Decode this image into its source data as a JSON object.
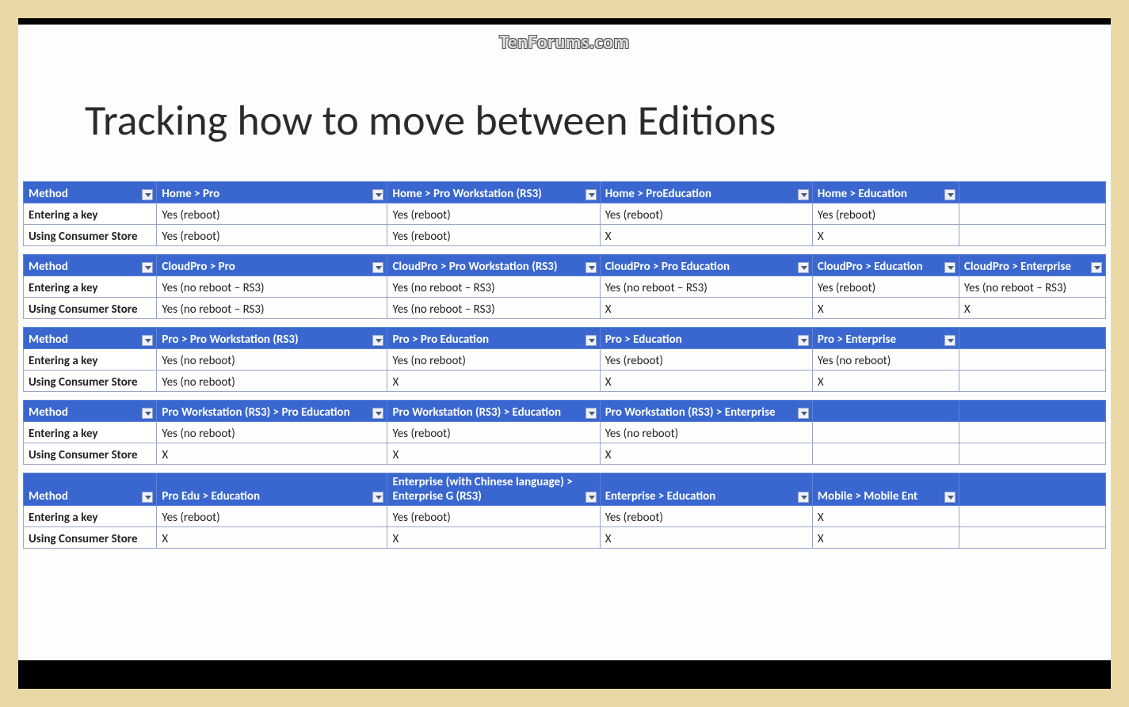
{
  "watermark": "TenForums.com",
  "title": "Tracking how to move between Editions",
  "colHeaders": {
    "method": "Method"
  },
  "tables": [
    {
      "cols": [
        "Home > Pro",
        "Home > Pro Workstation (RS3)",
        "Home > ProEducation",
        "Home > Education",
        ""
      ],
      "rows": [
        {
          "label": "Entering a key",
          "cells": [
            "Yes (reboot)",
            "Yes (reboot)",
            "Yes (reboot)",
            "Yes (reboot)",
            ""
          ]
        },
        {
          "label": "Using Consumer Store",
          "cells": [
            "Yes (reboot)",
            "Yes (reboot)",
            "X",
            "X",
            ""
          ]
        }
      ]
    },
    {
      "cols": [
        "CloudPro > Pro",
        "CloudPro > Pro Workstation (RS3)",
        "CloudPro > Pro Education",
        "CloudPro > Education",
        "CloudPro > Enterprise"
      ],
      "rows": [
        {
          "label": "Entering a key",
          "cells": [
            "Yes (no reboot – RS3)",
            "Yes (no reboot – RS3)",
            "Yes (no reboot – RS3)",
            "Yes (reboot)",
            "Yes (no reboot – RS3)"
          ]
        },
        {
          "label": "Using Consumer Store",
          "cells": [
            "Yes (no reboot – RS3)",
            "Yes (no reboot – RS3)",
            "X",
            "X",
            "X"
          ]
        }
      ]
    },
    {
      "cols": [
        "Pro > Pro Workstation (RS3)",
        "Pro > Pro Education",
        "Pro > Education",
        "Pro > Enterprise",
        ""
      ],
      "rows": [
        {
          "label": "Entering a key",
          "cells": [
            "Yes (no reboot)",
            "Yes (no reboot)",
            "Yes (reboot)",
            "Yes (no reboot)",
            ""
          ]
        },
        {
          "label": "Using Consumer Store",
          "cells": [
            "Yes (no reboot)",
            "X",
            "X",
            "X",
            ""
          ]
        }
      ]
    },
    {
      "tallHeader": true,
      "cols": [
        "Pro Workstation (RS3) > Pro Education",
        "Pro Workstation (RS3) > Education",
        "Pro Workstation (RS3) > Enterprise",
        "",
        ""
      ],
      "rows": [
        {
          "label": "Entering a key",
          "cells": [
            "Yes (no reboot)",
            "Yes (reboot)",
            "Yes (no reboot)",
            "",
            ""
          ]
        },
        {
          "label": "Using Consumer Store",
          "cells": [
            "X",
            "X",
            "X",
            "",
            ""
          ]
        }
      ]
    },
    {
      "cols": [
        "Pro Edu > Education",
        "Enterprise (with Chinese language) > Enterprise G (RS3)",
        "Enterprise > Education",
        "Mobile > Mobile Ent",
        ""
      ],
      "rows": [
        {
          "label": "Entering a key",
          "cells": [
            "Yes (reboot)",
            "Yes (reboot)",
            "Yes (reboot)",
            "X",
            ""
          ]
        },
        {
          "label": "Using Consumer Store",
          "cells": [
            "X",
            "X",
            "X",
            "X",
            ""
          ]
        }
      ]
    }
  ]
}
